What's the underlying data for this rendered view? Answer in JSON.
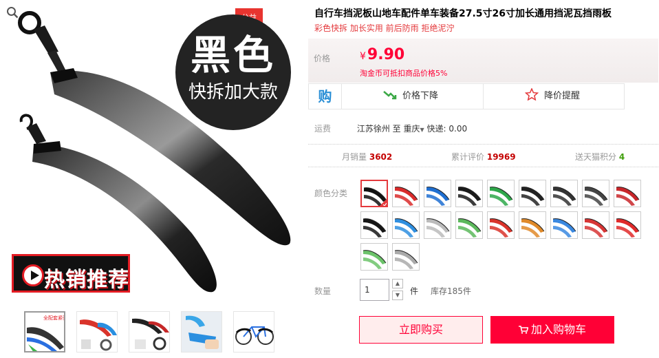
{
  "gallery": {
    "badge_big": "黑色",
    "badge_small": "快拆加大款",
    "welfare_badge": [
      "公益",
      "宝贝"
    ],
    "hot_banner": "热销推荐",
    "thumb_captions": [
      "全配套紧强"
    ]
  },
  "product": {
    "title": "自行车挡泥板山地车配件单车装备27.5寸26寸加长通用挡泥瓦挡雨板",
    "subtitle": "彩色快拆 加长实用 前后防雨 拒绝泥泞"
  },
  "price": {
    "label": "价格",
    "currency": "¥",
    "value": "9.90",
    "note": "淘金币可抵扣商品价格5%"
  },
  "alerts": {
    "gou_icon_text": "购",
    "price_drop": "价格下降",
    "price_reminder": "降价提醒"
  },
  "shipping": {
    "label": "运费",
    "from": "江苏徐州",
    "to_word": "至",
    "to": "重庆",
    "dropdown_glyph": "▼",
    "method": "快递: 0.00"
  },
  "stats": {
    "monthly_sales_label": "月销量",
    "monthly_sales": "3602",
    "reviews_label": "累计评价",
    "reviews": "19969",
    "points_label": "送天猫积分",
    "points": "4"
  },
  "color": {
    "label": "颜色分类",
    "swatch_colors": [
      "#111111",
      "#d92b2b",
      "#1f6fd1",
      "#1a1a1a",
      "#2ea84a",
      "#222222",
      "#333333",
      "#444444",
      "#c8262a",
      "#151515",
      "#2f8fe0",
      "#bbbbbb",
      "#5cb85c",
      "#d9342b",
      "#e08a2a",
      "#3a88e0",
      "#d73535",
      "#e02a2a",
      "#6cc36a",
      "#aaaaaa"
    ],
    "selected_index": 0
  },
  "quantity": {
    "label": "数量",
    "value": "1",
    "unit": "件",
    "stock": "库存185件",
    "up_glyph": "▲",
    "down_glyph": "▼"
  },
  "actions": {
    "buy_now": "立即购买",
    "add_to_cart": "加入购物车"
  },
  "colors": {
    "accent": "#ff0036",
    "title_red": "#e4393c",
    "link_blue": "#2a8fd6",
    "points_green": "#429f0c"
  }
}
